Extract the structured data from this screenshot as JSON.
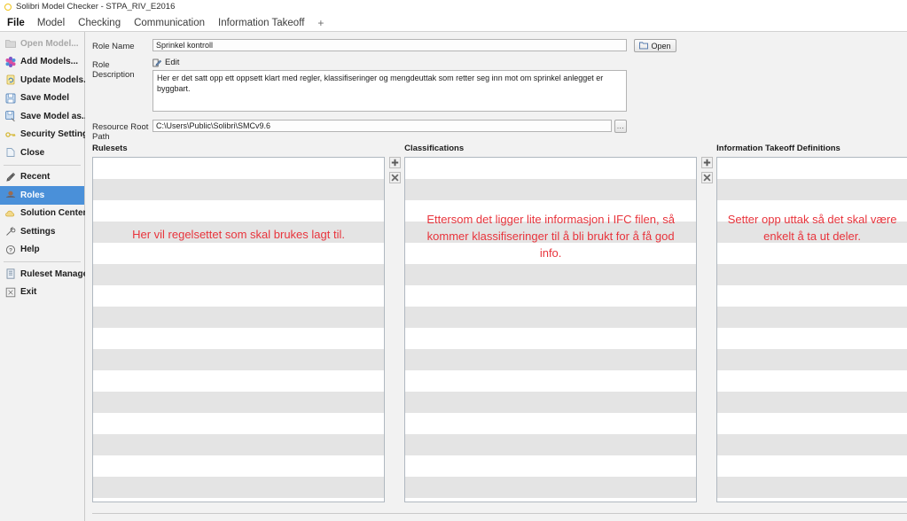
{
  "window": {
    "app_icon": "circle-logo-icon",
    "title": "Solibri Model Checker - STPA_RIV_E2016"
  },
  "menubar": {
    "items": [
      {
        "label": "File",
        "icon": "none",
        "active": true
      },
      {
        "label": "Model",
        "icon": "none",
        "active": false
      },
      {
        "label": "Checking",
        "icon": "none",
        "active": false
      },
      {
        "label": "Communication",
        "icon": "none",
        "active": false
      },
      {
        "label": "Information Takeoff",
        "icon": "none",
        "active": false
      },
      {
        "label": "+",
        "icon": "plus-icon",
        "active": false
      }
    ]
  },
  "sidebar": {
    "items": [
      {
        "label": "Open Model...",
        "icon": "open-folder-icon",
        "state": "disabled"
      },
      {
        "label": "Add Models...",
        "icon": "add-models-icon",
        "state": "normal"
      },
      {
        "label": "Update Models...",
        "icon": "update-models-icon",
        "state": "normal"
      },
      {
        "label": "Save Model",
        "icon": "save-icon",
        "state": "normal"
      },
      {
        "label": "Save Model as...",
        "icon": "save-as-icon",
        "state": "normal"
      },
      {
        "label": "Security Settings...",
        "icon": "key-icon",
        "state": "normal"
      },
      {
        "label": "Close",
        "icon": "close-doc-icon",
        "state": "normal"
      },
      {
        "label": "Recent",
        "icon": "recent-icon",
        "state": "normal"
      },
      {
        "label": "Roles",
        "icon": "roles-icon",
        "state": "selected"
      },
      {
        "label": "Solution Center",
        "icon": "cloud-icon",
        "state": "normal"
      },
      {
        "label": "Settings",
        "icon": "wrench-icon",
        "state": "normal"
      },
      {
        "label": "Help",
        "icon": "help-icon",
        "state": "normal"
      },
      {
        "label": "Ruleset Manager",
        "icon": "ruleset-manager-icon",
        "state": "normal"
      },
      {
        "label": "Exit",
        "icon": "exit-icon",
        "state": "normal"
      }
    ],
    "selected_color": "#4a90d9"
  },
  "form": {
    "role_name_label": "Role Name",
    "role_name_value": "Sprinkel kontroll",
    "open_button_label": "Open",
    "role_description_label": "Role Description",
    "edit_label": "Edit",
    "role_description_value": "Her er det satt opp ett oppsett klart med regler, klassifiseringer og mengdeuttak som retter seg inn mot om sprinkel anlegget er byggbart.",
    "resource_root_path_label": "Resource Root Path",
    "resource_root_path_value": "C:\\Users\\Public\\Solibri\\SMCv9.6",
    "browse_button_label": "..."
  },
  "columns": {
    "rulesets": {
      "header": "Rulesets",
      "note": "Her vil regelsettet som skal brukes lagt til.",
      "items": [],
      "add_button": "+",
      "remove_button": "✕"
    },
    "classifications": {
      "header": "Classifications",
      "note": "Ettersom det ligger lite informasjon i IFC filen, så kommer klassifiseringer til å bli brukt for å få god info.",
      "items": [],
      "add_button": "+",
      "remove_button": "✕"
    },
    "takeoff": {
      "header": "Information Takeoff Definitions",
      "note": "Setter opp uttak så det skal være enkelt å ta ut deler.",
      "items": []
    }
  },
  "colors": {
    "annotation_red": "#e8343c",
    "selection_blue": "#4a90d9",
    "row_stripe": "#e4e4e4",
    "panel_bg": "#f2f2f2"
  }
}
